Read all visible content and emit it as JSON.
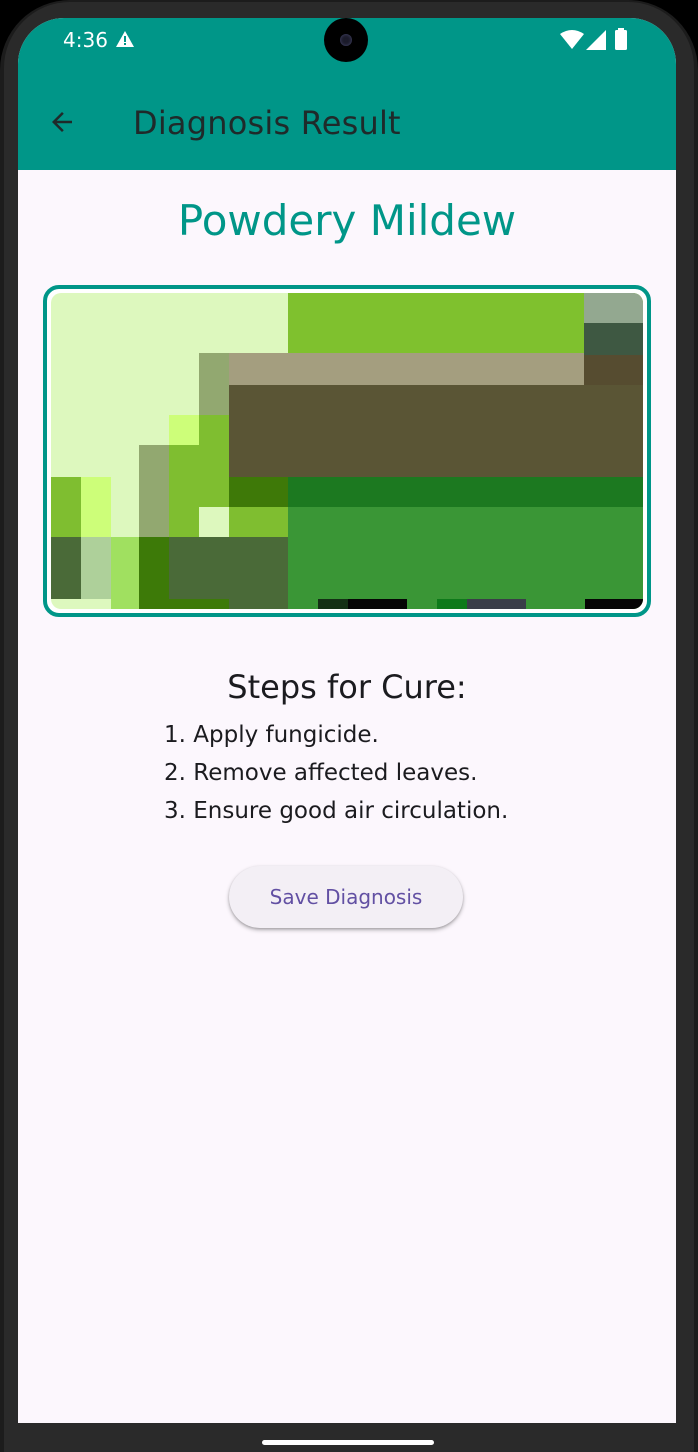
{
  "status_bar": {
    "time": "4:36",
    "icons": [
      "warning-icon",
      "wifi-icon",
      "cellular-signal-icon",
      "battery-icon"
    ]
  },
  "app_bar": {
    "title": "Diagnosis Result",
    "back_icon": "arrow-back-icon"
  },
  "result": {
    "disease_name": "Powdery Mildew",
    "image": "leaf-photo"
  },
  "cure": {
    "heading": "Steps for Cure:",
    "steps": [
      "1. Apply fungicide.",
      "2. Remove affected leaves.",
      "3. Ensure good air circulation."
    ]
  },
  "actions": {
    "save_label": "Save Diagnosis"
  },
  "colors": {
    "primary": "#009688",
    "background": "#FCF7FD",
    "button_text": "#6250A3",
    "button_bg": "#F3EFF5"
  }
}
